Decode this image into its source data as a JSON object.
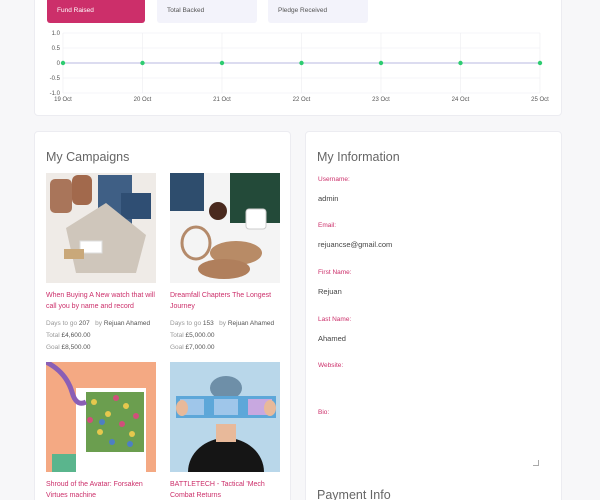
{
  "tabs": [
    "Fund Raised",
    "Total Backed",
    "Pledge Received"
  ],
  "chart_data": {
    "type": "line",
    "categories": [
      "19 Oct",
      "20 Oct",
      "21 Oct",
      "22 Oct",
      "23 Oct",
      "24 Oct",
      "25 Oct"
    ],
    "values": [
      0,
      0,
      0,
      0,
      0,
      0,
      0
    ],
    "y_ticks": [
      "1.0",
      "0.5",
      "0",
      "-0.5",
      "-1.0"
    ],
    "ylim": [
      -1.0,
      1.0
    ],
    "grid": true,
    "colors": {
      "line": "#b8b8e0",
      "point": "#2ecc71"
    }
  },
  "campaigns": {
    "title": "My Campaigns",
    "items": [
      {
        "title": "When Buying A New watch that will call you by name and record",
        "days_label": "Days to go",
        "days": "207",
        "by_label": "by",
        "author": "Rejuan Ahamed",
        "total_label": "Total",
        "total": "£4,600.00",
        "goal_label": "Goal",
        "goal": "£8,500.00"
      },
      {
        "title": "Dreamfall Chapters The Longest Journey",
        "days_label": "Days to go",
        "days": "153",
        "by_label": "by",
        "author": "Rejuan Ahamed",
        "total_label": "Total",
        "total": "£5,000.00",
        "goal_label": "Goal",
        "goal": "£7,000.00"
      },
      {
        "title": "Shroud of the Avatar: Forsaken Virtues machine"
      },
      {
        "title": "BATTLETECH - Tactical 'Mech Combat Returns"
      }
    ]
  },
  "info": {
    "title": "My Information",
    "username_label": "Username:",
    "username": "admin",
    "email_label": "Email:",
    "email": "rejuancse@gmail.com",
    "first_label": "First Name:",
    "first": "Rejuan",
    "last_label": "Last Name:",
    "last": "Ahamed",
    "website_label": "Website:",
    "bio_label": "Bio:",
    "payment_title": "Payment Info"
  }
}
